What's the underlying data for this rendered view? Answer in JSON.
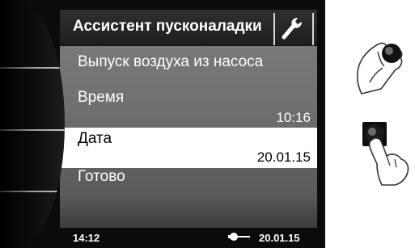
{
  "header": {
    "title": "Ассистент пусконаладки",
    "tool_icon": "wrench-icon"
  },
  "menu": {
    "items": [
      {
        "label": "Выпуск воздуха из насоса",
        "value": ""
      },
      {
        "label": "Время",
        "value": "10:16"
      },
      {
        "label": "Дата",
        "value": "20.01.15",
        "selected": true
      },
      {
        "label": "Готово",
        "value": ""
      }
    ]
  },
  "status_bar": {
    "time": "14:12",
    "date": "20.01.15",
    "icon": "plug-icon"
  },
  "illustrations": {
    "top": "hand-turning-knob-icon",
    "bottom": "hand-pressing-knob-icon"
  },
  "colors": {
    "selected_background": "#ffffff",
    "screen_background": "#707070",
    "title_background": "#1e1e1e"
  }
}
